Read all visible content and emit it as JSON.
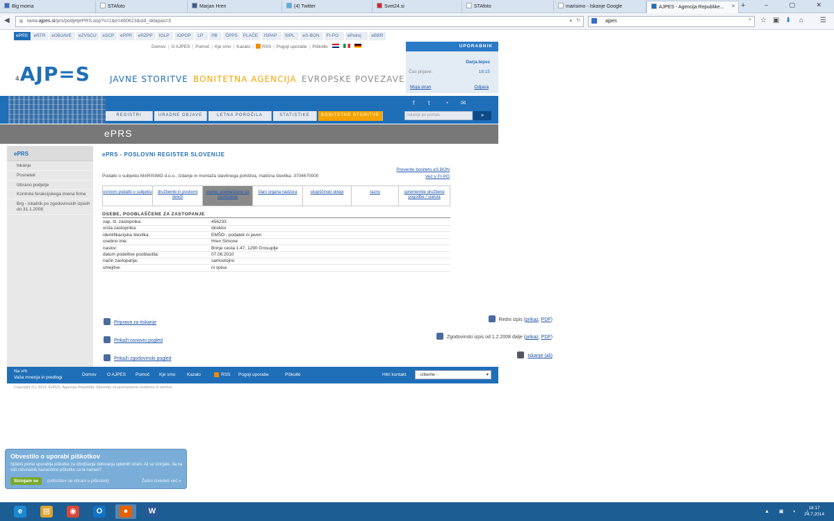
{
  "browser": {
    "tabs": [
      {
        "label": "Big moma",
        "color": "#3b6ec9"
      },
      {
        "label": "STAfoto",
        "color": "#ffffff"
      },
      {
        "label": "Marjan Hren",
        "color": "#3b5998"
      },
      {
        "label": "(4) Twitter",
        "color": "#55acee"
      },
      {
        "label": "Svet24.si",
        "color": "#d7282f"
      },
      {
        "label": "STAfoto",
        "color": "#ffffff"
      },
      {
        "label": "marisimo - Iskanje Google",
        "color": "#ffffff"
      },
      {
        "label": "AJPES - Agencija Republike...",
        "color": "#1f6eb8"
      }
    ],
    "active_tab": 7,
    "new_tab": "+",
    "url_prefix": "www.",
    "url_host": "ajpes.si",
    "url_rest": "/prs/podjetjePRS.asp?s=1&e=460623&sid_sklapas=3",
    "search_value": "ajpes",
    "window_controls": "– ▢ ✕"
  },
  "site": {
    "topnav": [
      "ePRS",
      "eRTR",
      "eOBJAVE",
      "eZVSCU",
      "eSCP",
      "ePPR",
      "eRZPP",
      "IOLP",
      "IOPOP",
      "LP",
      "PB",
      "ČPPS",
      "PLAČE",
      "ISPAP",
      "SIPL",
      "eS-BON",
      "FI-PO",
      "ePokoj",
      "eBBR"
    ],
    "utility": [
      "Domov",
      "O AJPES",
      "Pomoč",
      "Kje smo",
      "Kazalo",
      "RSS",
      "Pogoji uporabe",
      "Piškotki"
    ],
    "logo": "AJP=S",
    "logo_sub": [
      "4",
      "1",
      "5"
    ],
    "sections": [
      {
        "label": "JAVNE STORITVE",
        "color": "#1f6eb8"
      },
      {
        "label": "BONITETNA AGENCIJA",
        "color": "#f4a300"
      },
      {
        "label": "EVROPSKE POVEZAVE",
        "color": "#8a8a8a"
      }
    ],
    "user": {
      "header": "UPORABNIK",
      "name": "Darja.tepez",
      "time_label": "Čas prijave:",
      "time_value": "18:15",
      "my_page": "Moja stran",
      "logout": "Odjava"
    },
    "banner_tabs": [
      "REGISTRI",
      "URADNE OBJAVE",
      "LETNA POROČILA",
      "STATISTIKE",
      "BONITETNE STORITVE"
    ],
    "banner_active": 4,
    "banner_search_placeholder": "Iskanje po portalu",
    "banner_search_btn": "»"
  },
  "graybar_title": "ePRS",
  "sidebar": {
    "title": "ePRS",
    "items": [
      "Iskanje",
      "Posnetek",
      "Izbrano podjetje",
      "Kontrola ferakcijskega imena firme",
      "Brg - iskalnik po zgodovinskih izpisih do 31.1.2008"
    ]
  },
  "main": {
    "title": "ePRS - POSLOVNI REGISTER SLOVENIJE",
    "intro": "Podatki o subjektu MARISIMO d.o.o., Izdanje in montaža stavbnega pohištva, matična številka: 3704670000",
    "links_right": [
      "Preverite boniteto eS.BON",
      "Več v FI-PO"
    ],
    "subtabs": [
      {
        "label": "osnovni podatki o subjektu",
        "w": 72
      },
      {
        "label": "družbeniki in poslovni deleži",
        "w": 72
      },
      {
        "label": "osebe, pooblaščene za zastopanje",
        "w": 72
      },
      {
        "label": "člani organa nadzora",
        "w": 72
      },
      {
        "label": "skupščinski sklepi",
        "w": 70
      },
      {
        "label": "razno",
        "w": 68
      },
      {
        "label": "spremembe družbene pogodbe / statuta",
        "w": 74
      }
    ],
    "subtab_active": 2,
    "section_title": "OSEBE, POOBLAŠČENE ZA ZASTOPANJE",
    "fields": [
      {
        "k": "zap. št. zastopnika:",
        "v": "456233"
      },
      {
        "k": "vrsta zastopnika:",
        "v": "direktor"
      },
      {
        "k": "identifikacijska številka:",
        "v": "EMŠO - podatek ni javen"
      },
      {
        "k": "osebno ime:",
        "v": "Hren Simone"
      },
      {
        "k": "naslov:",
        "v": "Brinje cesta 1.47, 1290 Grosuplje"
      },
      {
        "k": "datum podelitve pooblastila:",
        "v": "07.06.2010"
      },
      {
        "k": "način zastopanja:",
        "v": "samostojno"
      },
      {
        "k": "omejitve:",
        "v": "ni vpisa"
      }
    ],
    "actions_left": [
      "Priprava za tiskanje",
      "Prikaži osnovni pogled",
      "Prikaži zgodovinski pogled"
    ],
    "actions_right": [
      {
        "label": "Redni izpis",
        "a": "prikaz",
        "b": "PDF"
      },
      {
        "label": "Zgodovinski izpis od 1.2.2008 dalje",
        "a": "prikaz",
        "b": "PDF"
      },
      {
        "label": "Iskanje (ali)",
        "a": "",
        "b": ""
      }
    ]
  },
  "footer": {
    "back": "Na vrh",
    "opinion": "Vaša mnenja in predlogi",
    "links": [
      "Domov",
      "O AJPES",
      "Pomoč",
      "Kje smo",
      "Kazalo",
      "RSS",
      "Pogoji uporabe",
      "Piškotki"
    ],
    "quick_label": "Hitri kontakt",
    "quick_value": "- izberite -",
    "copyright": "Copyright (C) 2014, AJPES, Agencija Republike Slovenije za javnopravne evidence in storitve"
  },
  "cookie": {
    "title": "Obvestilo o uporabi piškotkov",
    "text": "Spletni portal uporablja piškotke za izboljšanje delovanja spletnih strani. Ali se strinjate, da na vaš računalnik namestimo piškotke za ta namen?",
    "accept": "Strinjam se",
    "decline": "(odločitev se shrani v piškotek)",
    "more": "Želim izvedeti več »"
  },
  "taskbar": {
    "apps": [
      {
        "name": "ie-icon",
        "glyph": "e",
        "color": "#1c88d0"
      },
      {
        "name": "explorer-icon",
        "glyph": "▤",
        "color": "#d8a531"
      },
      {
        "name": "chrome-icon",
        "glyph": "◉",
        "color": "#d64937"
      },
      {
        "name": "outlook-icon",
        "glyph": "O",
        "color": "#1173c4"
      },
      {
        "name": "firefox-icon",
        "glyph": "●",
        "color": "#e66000"
      },
      {
        "name": "word-icon",
        "glyph": "W",
        "color": "#2b5797"
      }
    ],
    "time": "18:17",
    "date": "24.7.2014",
    "tray": "▲ ▣ ◐ ♪"
  }
}
